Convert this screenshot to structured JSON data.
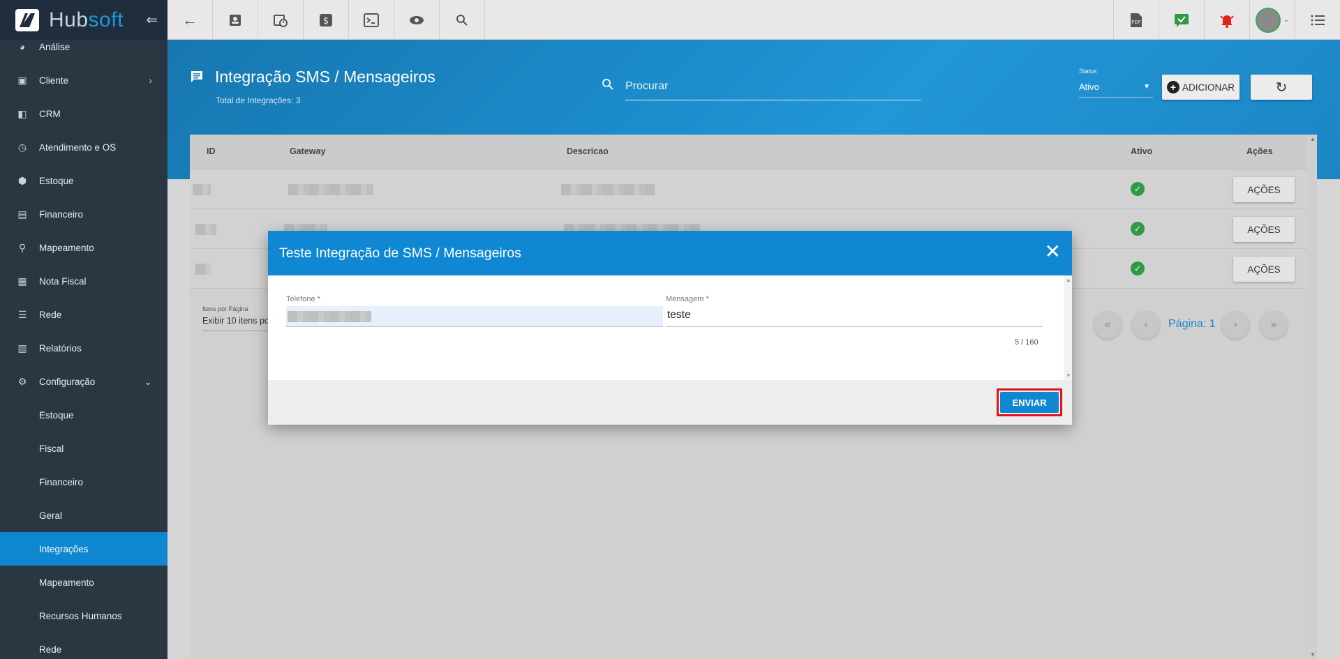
{
  "brand": {
    "name_part1": "Hub",
    "name_part2": "soft"
  },
  "topbar": {
    "icons": [
      "back-arrow-icon",
      "contact-card-icon",
      "calendar-clock-icon",
      "dollar-icon",
      "terminal-icon",
      "eye-icon",
      "search-icon"
    ],
    "right_icons": [
      "pdf-icon",
      "task-check-icon",
      "alarm-bell-icon",
      "user-avatar",
      "menu-list-icon"
    ]
  },
  "sidebar": {
    "items": [
      {
        "label": "Análise",
        "icon": "chart-icon"
      },
      {
        "label": "Cliente",
        "icon": "contact-card-icon",
        "chevron": "›"
      },
      {
        "label": "CRM",
        "icon": "kanban-icon"
      },
      {
        "label": "Atendimento e OS",
        "icon": "calendar-clock-icon"
      },
      {
        "label": "Estoque",
        "icon": "box-icon"
      },
      {
        "label": "Financeiro",
        "icon": "money-icon"
      },
      {
        "label": "Mapeamento",
        "icon": "map-pin-icon"
      },
      {
        "label": "Nota Fiscal",
        "icon": "document-icon"
      },
      {
        "label": "Rede",
        "icon": "server-icon"
      },
      {
        "label": "Relatórios",
        "icon": "report-icon"
      },
      {
        "label": "Configuração",
        "icon": "gear-icon",
        "chevron": "⌄"
      }
    ],
    "subitems": [
      {
        "label": "Estoque",
        "active": false
      },
      {
        "label": "Fiscal",
        "active": false
      },
      {
        "label": "Financeiro",
        "active": false
      },
      {
        "label": "Geral",
        "active": false
      },
      {
        "label": "Integrações",
        "active": true
      },
      {
        "label": "Mapeamento",
        "active": false
      },
      {
        "label": "Recursos Humanos",
        "active": false
      },
      {
        "label": "Rede",
        "active": false
      }
    ]
  },
  "header": {
    "title": "Integração SMS / Mensageiros",
    "subtitle": "Total de Integrações: 3",
    "search_placeholder": "Procurar",
    "status_label": "Status",
    "status_value": "Ativo",
    "add_label": "ADICIONAR"
  },
  "table": {
    "columns": [
      "ID",
      "Gateway",
      "Descricao",
      "Ativo",
      "Ações"
    ],
    "row_action_label": "AÇÕES",
    "rows_count_visible": 3
  },
  "pagination": {
    "items_per_page_label": "Itens por Página",
    "items_per_page_value": "Exibir 10 itens por página",
    "page_label": "Página: 1"
  },
  "modal": {
    "title": "Teste Integração de SMS / Mensageiros",
    "phone_label": "Telefone *",
    "message_label": "Mensagem *",
    "message_value": "teste",
    "counter": "5 / 160",
    "send_label": "ENVIAR"
  },
  "colors": {
    "primary": "#0f87d3",
    "sidebar_bg": "#2b3643",
    "highlight_outline": "#e0121b",
    "success": "#2e9a44"
  }
}
